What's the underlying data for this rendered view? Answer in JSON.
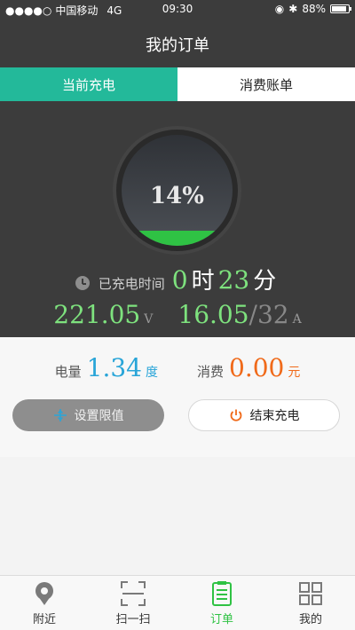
{
  "status_bar": {
    "carrier": "中国移动",
    "network": "4G",
    "time": "09:30",
    "battery_percent": "88%",
    "battery_level": 0.88
  },
  "header": {
    "title": "我的订单"
  },
  "tabs": [
    {
      "label": "当前充电",
      "active": true
    },
    {
      "label": "消费账单",
      "active": false
    }
  ],
  "charging": {
    "progress_text": "14%",
    "progress": 0.14,
    "elapsed_label": "已充电时间",
    "hours": "0",
    "hours_unit": "时",
    "minutes": "23",
    "minutes_unit": "分",
    "voltage": "221.05",
    "voltage_unit": "V",
    "current": "16.05",
    "current_max": "/32",
    "current_unit": "A"
  },
  "summary": {
    "energy_label": "电量",
    "energy_value": "1.34",
    "energy_unit": "度",
    "cost_label": "消费",
    "cost_value": "0.00",
    "cost_unit": "元"
  },
  "buttons": {
    "set_limit": "设置限值",
    "end_charging": "结束充电"
  },
  "tabbar": [
    {
      "label": "附近",
      "icon": "location-pin-icon"
    },
    {
      "label": "扫一扫",
      "icon": "scan-icon"
    },
    {
      "label": "订单",
      "icon": "order-icon",
      "active": true
    },
    {
      "label": "我的",
      "icon": "grid-icon"
    }
  ],
  "colors": {
    "accent_green": "#23b99a",
    "bright_green": "#2fc244",
    "dark_bg": "#3c3c3c",
    "blue": "#29a5d8",
    "orange": "#f06a1a"
  }
}
